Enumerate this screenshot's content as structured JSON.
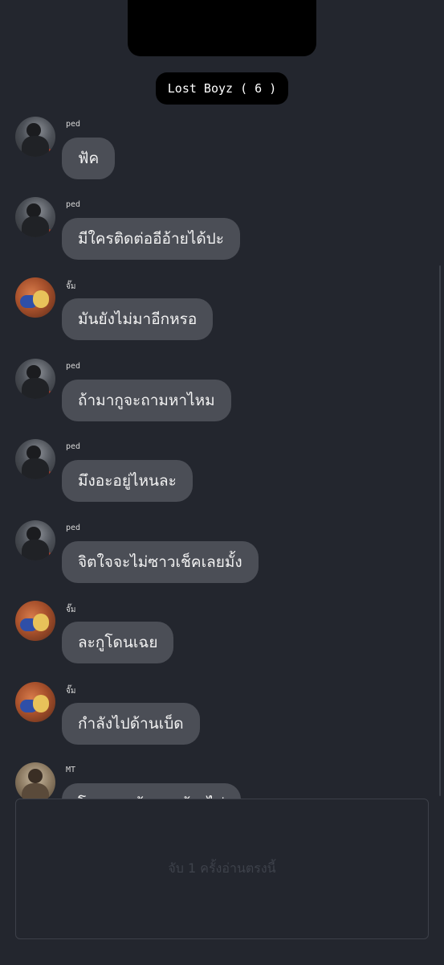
{
  "group": {
    "title": "Lost Boyz ( 6 )"
  },
  "messages": [
    {
      "sender": "ped",
      "avatar": "ped",
      "text": "ฟัค"
    },
    {
      "sender": "ped",
      "avatar": "ped",
      "text": "มีใครติดต่ออีอ้ายได้ปะ"
    },
    {
      "sender": "จั๊ม",
      "avatar": "jum",
      "text": "มันยังไม่มาอีกหรอ"
    },
    {
      "sender": "ped",
      "avatar": "ped",
      "text": "ถ้ามากูจะถามหาไหม"
    },
    {
      "sender": "ped",
      "avatar": "ped",
      "text": "มึงอะอยู่ไหนละ"
    },
    {
      "sender": "ped",
      "avatar": "ped",
      "text": "จิตใจจะไม่ซาวเช็คเลยมั้ง"
    },
    {
      "sender": "จั๊ม",
      "avatar": "jum",
      "text": "ละกูโดนเฉย"
    },
    {
      "sender": "จั๊ม",
      "avatar": "jum",
      "text": "กำลังไปด้านเบ็ด"
    },
    {
      "sender": "MT",
      "avatar": "mt",
      "text": "โดนของค้างคนพ้องไม่"
    }
  ],
  "composer": {
    "placeholder": "จับ 1 ครั้งอ่านตรงนี้"
  }
}
